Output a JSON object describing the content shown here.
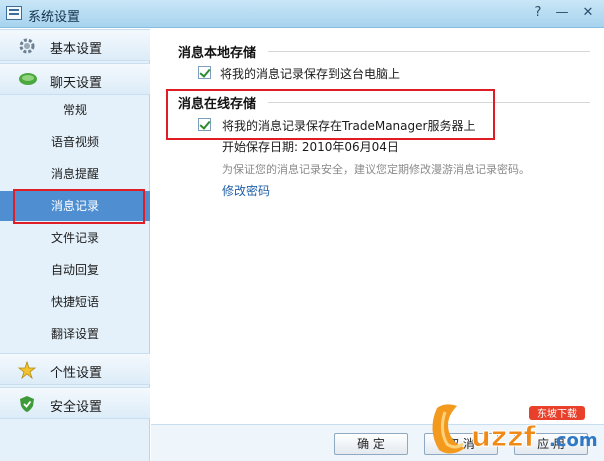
{
  "window": {
    "title": "系统设置",
    "help_glyph": "?",
    "minimize_glyph": "—",
    "close_glyph": "✕"
  },
  "sidebar": {
    "basic": {
      "label": "基本设置"
    },
    "chat": {
      "label": "聊天设置"
    },
    "sub_items": [
      {
        "label": "常规"
      },
      {
        "label": "语音视频"
      },
      {
        "label": "消息提醒"
      },
      {
        "label": "消息记录"
      },
      {
        "label": "文件记录"
      },
      {
        "label": "自动回复"
      },
      {
        "label": "快捷短语"
      },
      {
        "label": "翻译设置"
      }
    ],
    "personal": {
      "label": "个性设置"
    },
    "security": {
      "label": "安全设置"
    }
  },
  "content": {
    "local": {
      "title": "消息本地存储",
      "checkbox_label": "将我的消息记录保存到这台电脑上",
      "checked": true
    },
    "online": {
      "title": "消息在线存储",
      "checkbox_label": "将我的消息记录保存在TradeManager服务器上",
      "checked": true,
      "start_date": "开始保存日期: 2010年06月04日",
      "hint": "为保证您的消息记录安全，建议您定期修改漫游消息记录密码。",
      "change_password_link": "修改密码"
    }
  },
  "buttons": {
    "ok": "确 定",
    "cancel": "取 消",
    "apply": "应 用"
  },
  "watermark": {
    "brand": "uzzf",
    "suffix": ".com",
    "tag": "东坡下载"
  },
  "colors": {
    "highlight": "#e01d24",
    "active_item": "#4f8fd1",
    "link": "#1f5fa8"
  }
}
